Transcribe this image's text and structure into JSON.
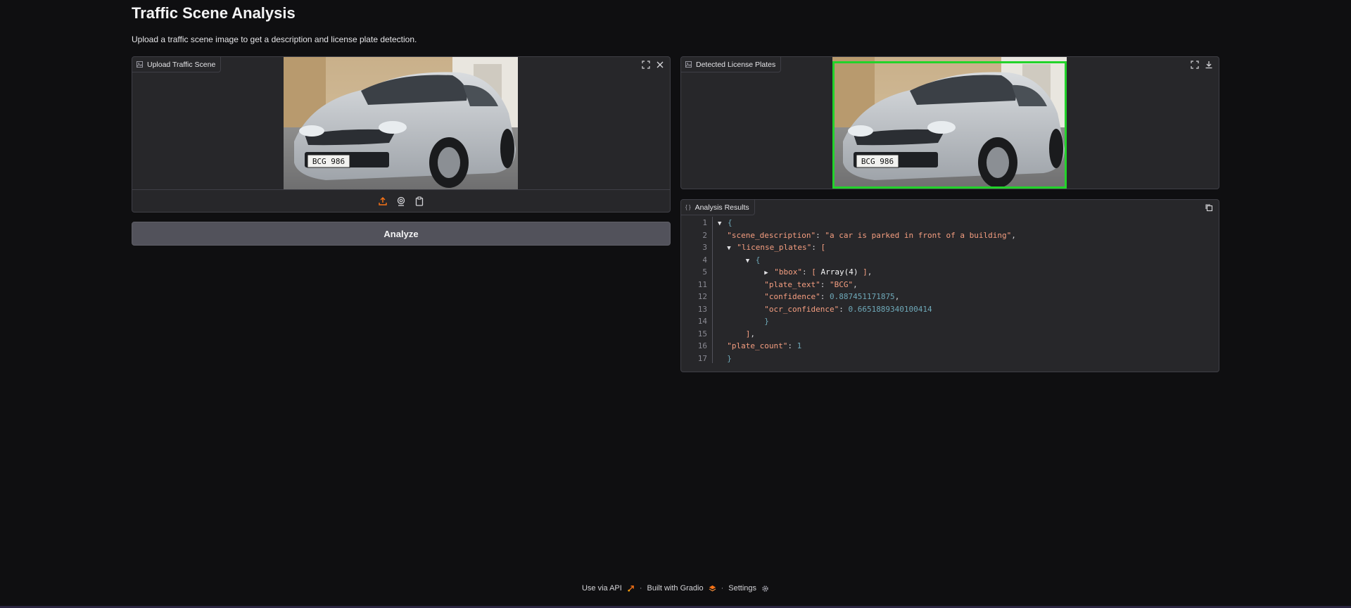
{
  "page": {
    "title": "Traffic Scene Analysis",
    "subtitle": "Upload a traffic scene image to get a description and license plate detection."
  },
  "upload": {
    "label": "Upload Traffic Scene",
    "plate_text": "BCG 986"
  },
  "detect": {
    "label": "Detected License Plates",
    "plate_text": "BCG 986"
  },
  "analyze_button": "Analyze",
  "results": {
    "label": "Analysis Results",
    "line_numbers": [
      "1",
      "2",
      "3",
      "4",
      "5",
      "11",
      "12",
      "13",
      "14",
      "15",
      "16",
      "17"
    ],
    "scene_description_key": "\"scene_description\"",
    "scene_description_value": "\"a car is parked in front of a building\"",
    "license_plates_key": "\"license_plates\"",
    "bbox_key": "\"bbox\"",
    "bbox_collapsed": "Array(4)",
    "plate_text_key": "\"plate_text\"",
    "plate_text_value": "\"BCG\"",
    "confidence_key": "\"confidence\"",
    "confidence_value": "0.887451171875",
    "ocr_confidence_key": "\"ocr_confidence\"",
    "ocr_confidence_value": "0.6651889340100414",
    "plate_count_key": "\"plate_count\"",
    "plate_count_value": "1"
  },
  "footer": {
    "api": "Use via API",
    "built": "Built with Gradio",
    "settings": "Settings",
    "sep": "·"
  },
  "colors": {
    "accent_orange": "#f97316",
    "bbox_green": "#22d32a"
  }
}
